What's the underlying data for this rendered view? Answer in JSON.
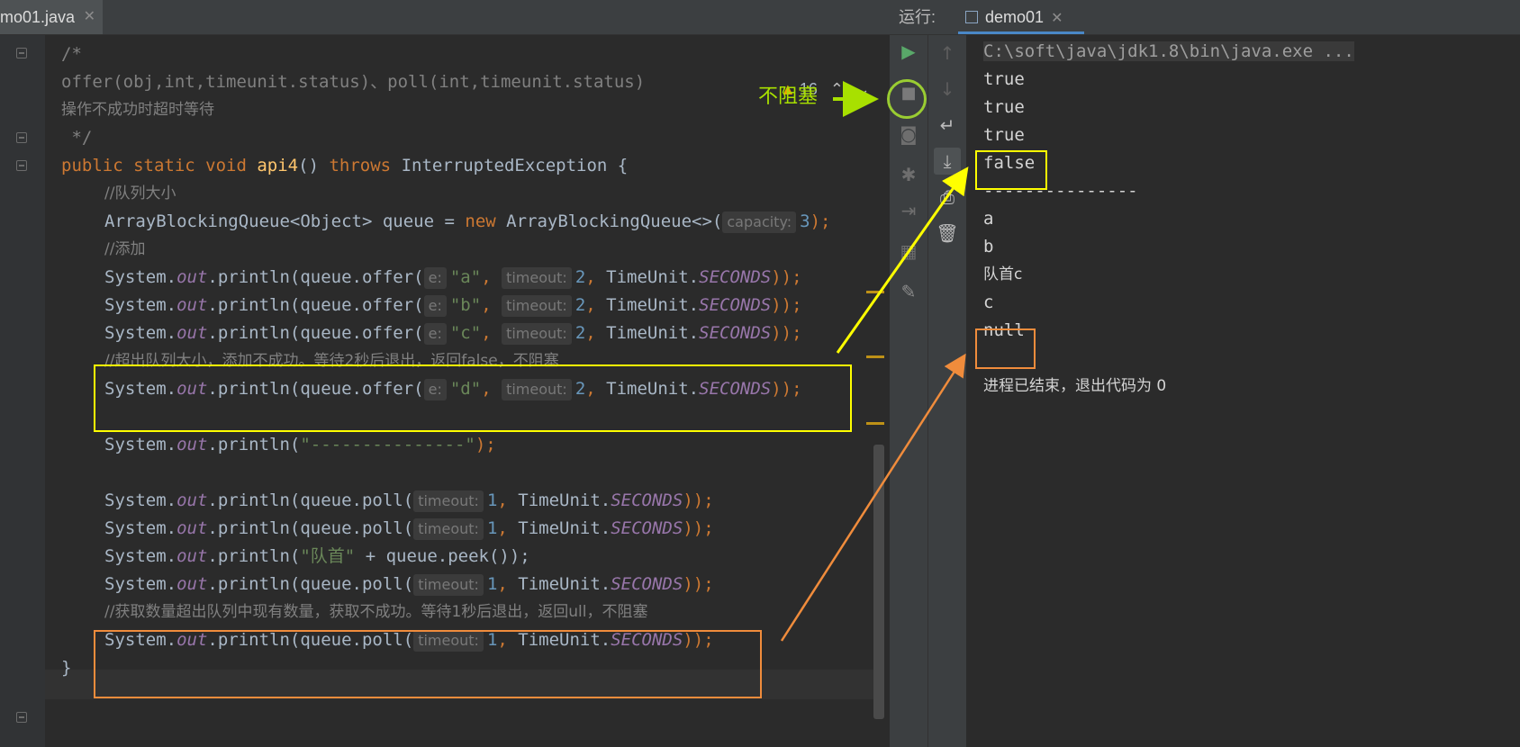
{
  "editor": {
    "tab_title": "mo01.java",
    "warnings": "16",
    "lines": {
      "l1": "/*",
      "l2": "offer(obj,int,timeunit.status)、poll(int,timeunit.status)",
      "l3": "操作不成功时超时等待",
      "l4": " */",
      "sig_mod": "public static void",
      "sig_name": "api4",
      "sig_paren": "()",
      "sig_throws": "throws",
      "sig_exc": "InterruptedException {",
      "c_size": "//队列大小",
      "decl_a": "ArrayBlockingQueue<Object> queue = ",
      "decl_new": "new",
      "decl_b": " ArrayBlockingQueue<>(",
      "hint_capacity": "capacity:",
      "decl_num": "3",
      "decl_end": ");",
      "c_add": "//添加",
      "sys": "System.",
      "out": "out",
      "println_offer": ".println(queue.offer(",
      "println_poll": ".println(queue.poll(",
      "println_open": ".println(",
      "hint_e": "e:",
      "hint_timeout": "timeout:",
      "str_a": "\"a\"",
      "str_b": "\"b\"",
      "str_c": "\"c\"",
      "str_d": "\"d\"",
      "comma": ", ",
      "num2": "2",
      "num1": "1",
      "timeunit": "TimeUnit.",
      "seconds": "SECONDS",
      "close2": "));",
      "c_exceed": "//超出队列大小，添加不成功。等待2秒后退出，返回false，不阻塞",
      "str_dash": "\"---------------\"",
      "close1": ");",
      "str_head": "\"队首\"",
      "peek": " + queue.peek());",
      "c_get": "//获取数量超出队列中现有数量，获取不成功。等待1秒后退出，返回ull，不阻塞",
      "brace": "}"
    }
  },
  "run": {
    "label": "运行:",
    "tab": "demo01",
    "console": [
      "C:\\soft\\java\\jdk1.8\\bin\\java.exe ...",
      "true",
      "true",
      "true",
      "false",
      "---------------",
      "a",
      "b",
      "队首c",
      "c",
      "null",
      "",
      "进程已结束，退出代码为 0"
    ]
  },
  "annotation": {
    "note": "不阻塞",
    "yellow": "#ffff00",
    "orange": "#f08c3c",
    "green": "#a8e000"
  }
}
